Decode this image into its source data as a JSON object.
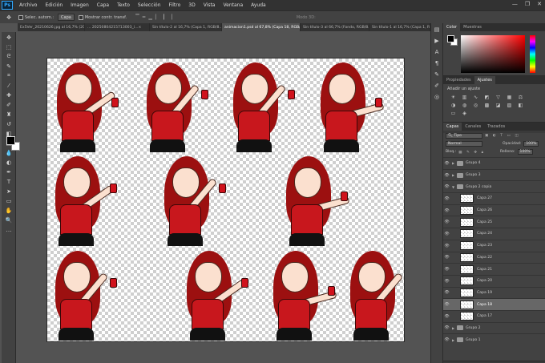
{
  "app": {
    "logo": "Ps"
  },
  "menu": [
    "Archivo",
    "Edición",
    "Imagen",
    "Capa",
    "Texto",
    "Selección",
    "Filtro",
    "3D",
    "Vista",
    "Ventana",
    "Ayuda"
  ],
  "window_controls": [
    "—",
    "❐",
    "✕"
  ],
  "options": {
    "auto_select": "Selec. autom.:",
    "auto_select_value": "Capa",
    "transform_controls": "Mostrar contr. transf.",
    "mode_3d": "Modo 3D:"
  },
  "doc_tabs": [
    "Ex5Ver_20210626.jpg al 16,7% (2007...",
    "... 20250804215713003_i...",
    "Sin título-2 al 16,7% (Capa 1, RGB/8...",
    "animacion1.psd al 67,8% (Capa 18, RGB/8) *",
    "Sin título-3 al 66,7% (Fondo, RGB/8...",
    "Sin título-1 al 16,7% (Capa 1, RGB/8..."
  ],
  "tools": [
    "move",
    "marquee",
    "lasso",
    "quick-select",
    "crop",
    "eyedropper",
    "heal",
    "brush",
    "stamp",
    "history-brush",
    "eraser",
    "gradient",
    "blur",
    "dodge",
    "pen",
    "type",
    "path-select",
    "shape",
    "hand",
    "zoom",
    "more"
  ],
  "panels": {
    "color_tabs": [
      "Color",
      "Muestras"
    ],
    "adjust_tabs": [
      "Propiedades",
      "Ajustes"
    ],
    "adjust_title": "Añadir un ajuste",
    "layers_tabs": [
      "Capas",
      "Canales",
      "Trazados"
    ],
    "filter_kind": "Tipo",
    "blend_mode": "Normal",
    "opacity_label": "Opacidad:",
    "opacity_value": "100%",
    "lock_label": "Bloq.:",
    "fill_label": "Relleno:",
    "fill_value": "100%"
  },
  "layers": [
    {
      "name": "Grupo 4",
      "kind": "group"
    },
    {
      "name": "Grupo 3",
      "kind": "group"
    },
    {
      "name": "Grupo 2 copia",
      "kind": "group-open"
    },
    {
      "name": "Capa 27",
      "kind": "layer"
    },
    {
      "name": "Capa 26",
      "kind": "layer"
    },
    {
      "name": "Capa 25",
      "kind": "layer"
    },
    {
      "name": "Capa 24",
      "kind": "layer"
    },
    {
      "name": "Capa 23",
      "kind": "layer"
    },
    {
      "name": "Capa 22",
      "kind": "layer"
    },
    {
      "name": "Capa 21",
      "kind": "layer"
    },
    {
      "name": "Capa 20",
      "kind": "layer"
    },
    {
      "name": "Capa 19",
      "kind": "layer"
    },
    {
      "name": "Capa 18",
      "kind": "layer",
      "selected": true
    },
    {
      "name": "Capa 17",
      "kind": "layer"
    },
    {
      "name": "Grupo 2",
      "kind": "group"
    },
    {
      "name": "Grupo 1",
      "kind": "group"
    }
  ]
}
